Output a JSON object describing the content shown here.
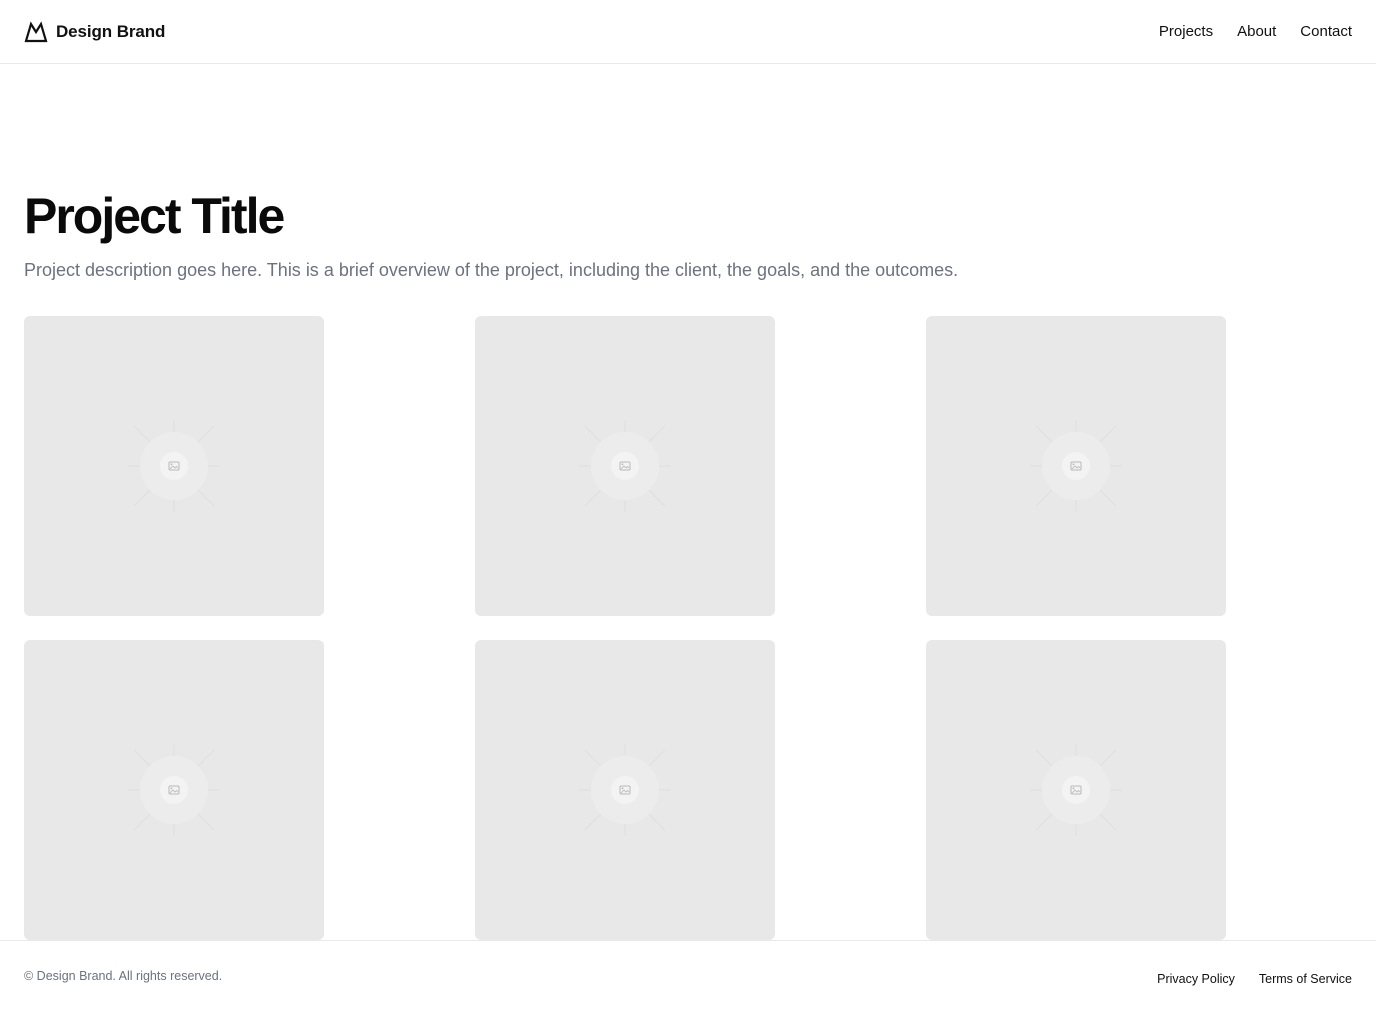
{
  "header": {
    "brand_name": "Design Brand",
    "brand_icon": "mountain-logo-icon",
    "nav": [
      {
        "label": "Projects"
      },
      {
        "label": "About"
      },
      {
        "label": "Contact"
      }
    ]
  },
  "hero": {
    "title": "Project Title",
    "description": "Project description goes here. This is a brief overview of the project, including the client, the goals, and the outcomes."
  },
  "gallery": {
    "tiles": [
      {
        "icon": "image-placeholder-icon"
      },
      {
        "icon": "image-placeholder-icon"
      },
      {
        "icon": "image-placeholder-icon"
      },
      {
        "icon": "image-placeholder-icon"
      },
      {
        "icon": "image-placeholder-icon"
      },
      {
        "icon": "image-placeholder-icon"
      }
    ]
  },
  "footer": {
    "copyright": "© Design Brand. All rights reserved.",
    "links": [
      {
        "label": "Privacy Policy"
      },
      {
        "label": "Terms of Service"
      }
    ]
  },
  "colors": {
    "placeholder_bg": "#e8e8e8",
    "muted_text": "#6b7280",
    "border": "#e9e9ec"
  }
}
